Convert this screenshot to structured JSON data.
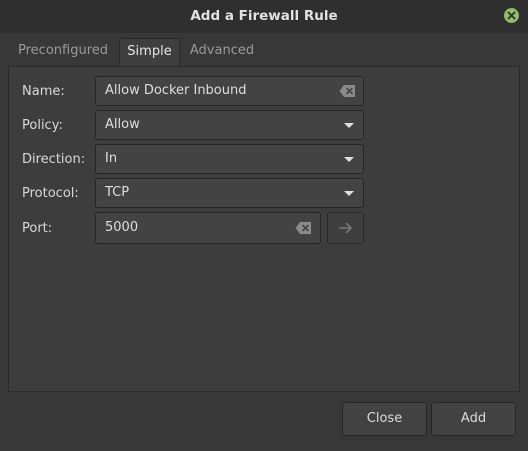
{
  "window": {
    "title": "Add a Firewall Rule"
  },
  "tabs": [
    {
      "label": "Preconfigured"
    },
    {
      "label": "Simple"
    },
    {
      "label": "Advanced"
    }
  ],
  "form": {
    "name": {
      "label": "Name:",
      "value": "Allow Docker Inbound"
    },
    "policy": {
      "label": "Policy:",
      "value": "Allow"
    },
    "direction": {
      "label": "Direction:",
      "value": "In"
    },
    "protocol": {
      "label": "Protocol:",
      "value": "TCP"
    },
    "port": {
      "label": "Port:",
      "value": "5000"
    }
  },
  "buttons": {
    "close": "Close",
    "add": "Add"
  },
  "colors": {
    "close_dot": "#8fbf6a",
    "background": "#383838"
  },
  "icons": [
    "close-icon",
    "clear-text-icon",
    "dropdown-arrow-icon",
    "arrow-right-icon"
  ]
}
